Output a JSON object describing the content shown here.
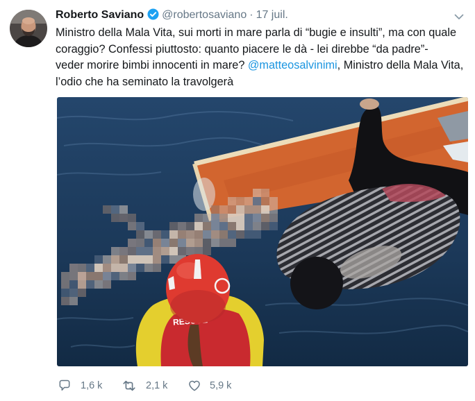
{
  "tweet": {
    "author": {
      "name": "Roberto Saviano",
      "handle": "@robertosaviano"
    },
    "separator": "·",
    "date": "17 juil.",
    "text": {
      "line1": "Ministro della Mala Vita, sui morti in mare parla di “bugie e insulti”, ma con quale",
      "line2": "coraggio? Confessi piuttosto: quanto piacere le dà - lei direbbe “da padre”-",
      "line3_before_mention": "veder morire bimbi innocenti in mare? ",
      "mention": "@matteosalvinimi",
      "line3_after_mention": ", Ministro della Mala Vita,",
      "line4": "l’odio che ha seminato la travolgerà"
    },
    "media": {
      "vest_label": "RESCUE"
    },
    "actions": [
      {
        "icon": "reply-icon",
        "count": "1,6 k"
      },
      {
        "icon": "retweet-icon",
        "count": "2,1 k"
      },
      {
        "icon": "like-heart-icon",
        "count": "5,9 k"
      }
    ]
  },
  "icons": {
    "verified": "verified-badge-icon",
    "menu": "chevron-down-icon"
  },
  "colors": {
    "text": "#14171a",
    "muted": "#657786",
    "mention": "#1b95e0",
    "verified": "#1da1f2",
    "background": "#ffffff"
  }
}
